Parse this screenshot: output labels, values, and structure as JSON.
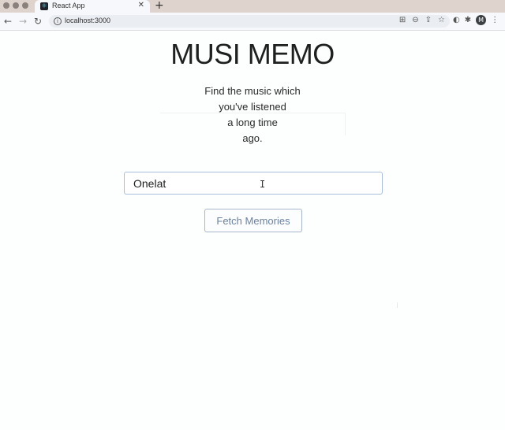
{
  "browser": {
    "tab_title": "React App",
    "tab_icon": "react-icon",
    "close_glyph": "✕",
    "new_tab_glyph": "+",
    "url": "localhost:3000",
    "avatar_letter": "M"
  },
  "app": {
    "title": "MUSI MEMO",
    "tagline_lines": [
      "Find the music which",
      "you've listened",
      "a long time",
      "ago."
    ],
    "search_value": "Onelat",
    "fetch_button_label": "Fetch Memories"
  }
}
